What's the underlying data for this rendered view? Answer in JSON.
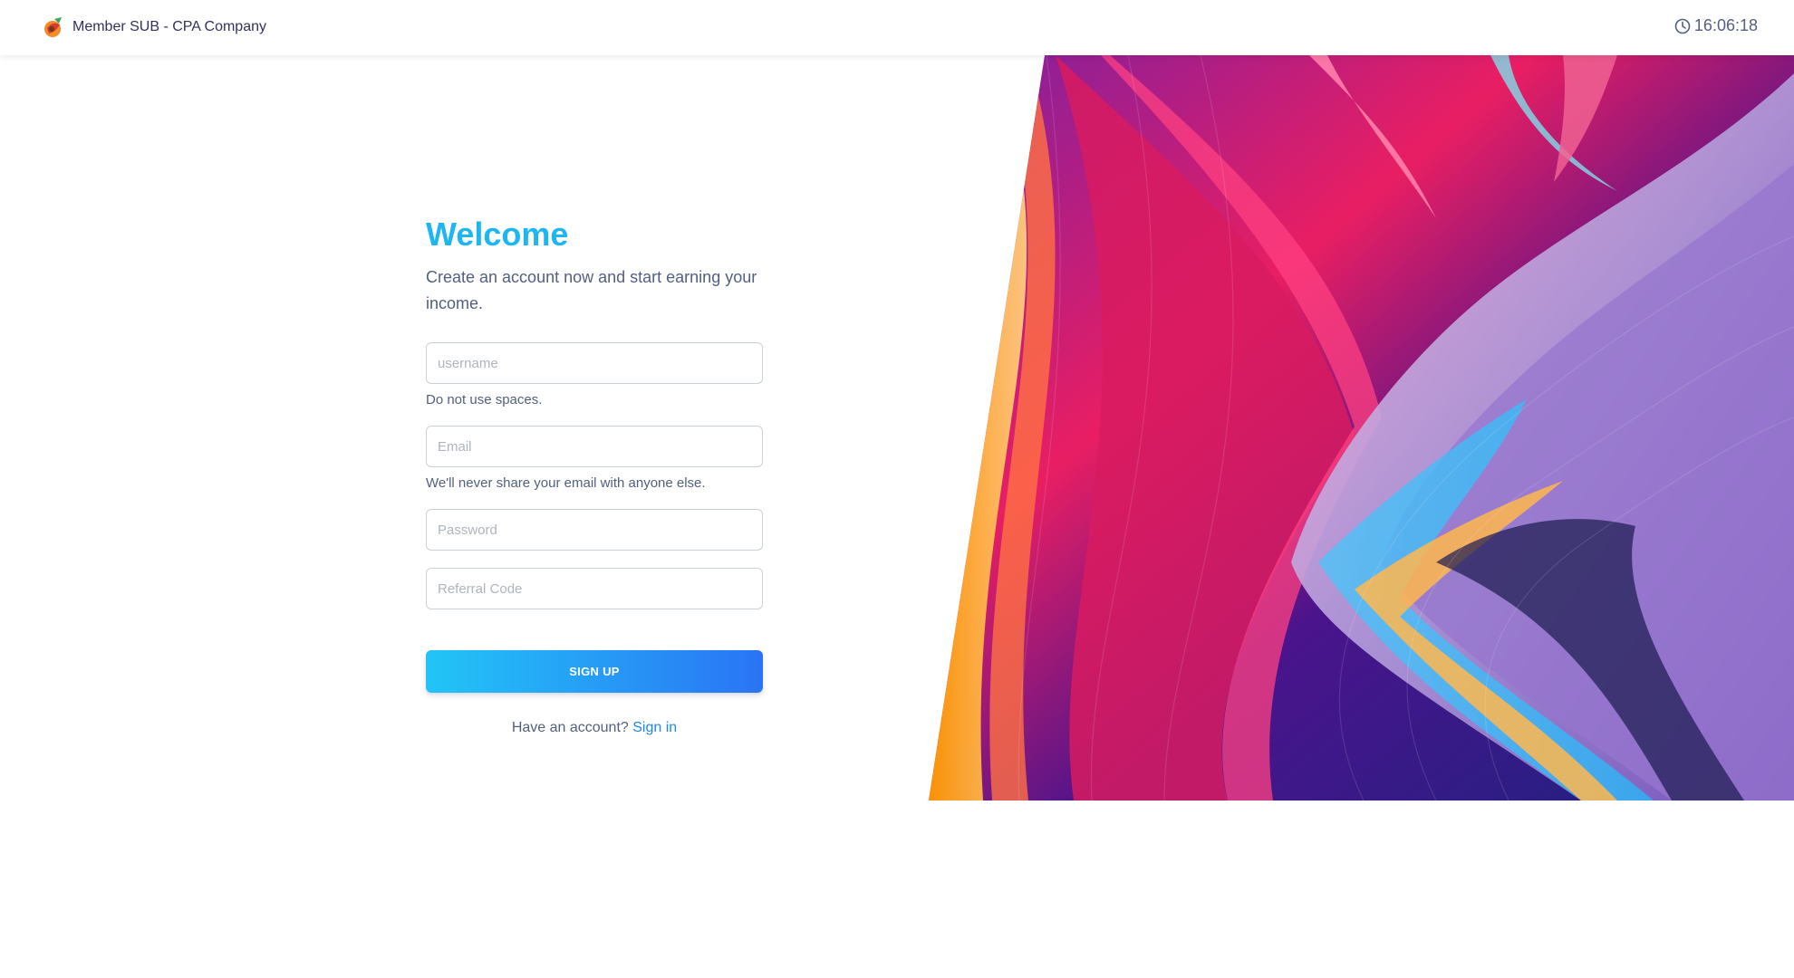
{
  "navbar": {
    "brand_name": "Member SUB - CPA Company",
    "brand_logo": "brand-logo-icon",
    "clock_icon": "clock-icon",
    "time": "16:06:18"
  },
  "form": {
    "title": "Welcome",
    "subtitle": "Create an account now and start earning your income.",
    "username": {
      "placeholder": "username",
      "value": "",
      "help": "Do not use spaces."
    },
    "email": {
      "placeholder": "Email",
      "value": "",
      "help": "We'll never share your email with anyone else."
    },
    "password": {
      "placeholder": "Password",
      "value": ""
    },
    "referral": {
      "placeholder": "Referral Code",
      "value": ""
    },
    "submit_label": "SIGN UP",
    "signin_prompt": "Have an account?",
    "signin_link": "Sign in"
  },
  "colors": {
    "accent": "#1cb6f3",
    "button_start": "#22c5f6",
    "button_end": "#2a74f5",
    "link": "#1e88e5"
  },
  "hero": {
    "description_icon": "abstract-colorful-waves-image"
  }
}
